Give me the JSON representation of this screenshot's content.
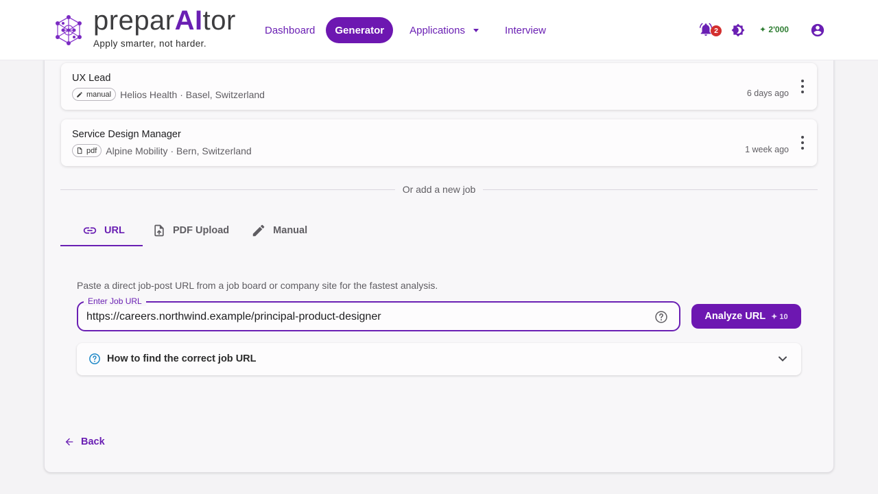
{
  "header": {
    "brand_prefix": "prepar",
    "brand_ai": "AI",
    "brand_suffix": "tor",
    "tagline": "Apply smarter, not harder.",
    "nav": [
      {
        "label": "Dashboard",
        "active": false
      },
      {
        "label": "Generator",
        "active": true
      },
      {
        "label": "Applications",
        "active": false,
        "has_dropdown": true
      },
      {
        "label": "Interview",
        "active": false
      }
    ],
    "notifications_count": "2",
    "credits": "✦ 2'000",
    "icons": [
      "bell-icon",
      "theme-icon",
      "account-icon"
    ]
  },
  "jobs": [
    {
      "title": "UX Lead",
      "source": "manual",
      "source_icon": "pencil-icon",
      "company": "Helios Health · Basel, Switzerland",
      "time": "6 days ago"
    },
    {
      "title": "Service Design Manager",
      "source": "pdf",
      "source_icon": "file-icon",
      "company": "Alpine Mobility · Bern, Switzerland",
      "time": "1 week ago"
    }
  ],
  "divider_text": "Or add a new job",
  "tabs": [
    {
      "label": "URL",
      "icon": "link-icon",
      "active": true
    },
    {
      "label": "PDF Upload",
      "icon": "file-upload-icon",
      "active": false
    },
    {
      "label": "Manual",
      "icon": "pencil-icon",
      "active": false
    }
  ],
  "url_form": {
    "hint": "Paste a direct job-post URL from a job board or company site for the fastest analysis.",
    "label": "Enter Job URL",
    "value": "https://careers.northwind.example/principal-product-designer",
    "button_label": "Analyze URL",
    "button_cost": "✦ 10"
  },
  "accordion": {
    "label": "How to find the correct job URL"
  },
  "back_label": "Back",
  "colors": {
    "accent": "#6a1fb3",
    "accent_button": "#6d17b1",
    "badge": "#d32f2f",
    "credits": "#2e7d32"
  }
}
